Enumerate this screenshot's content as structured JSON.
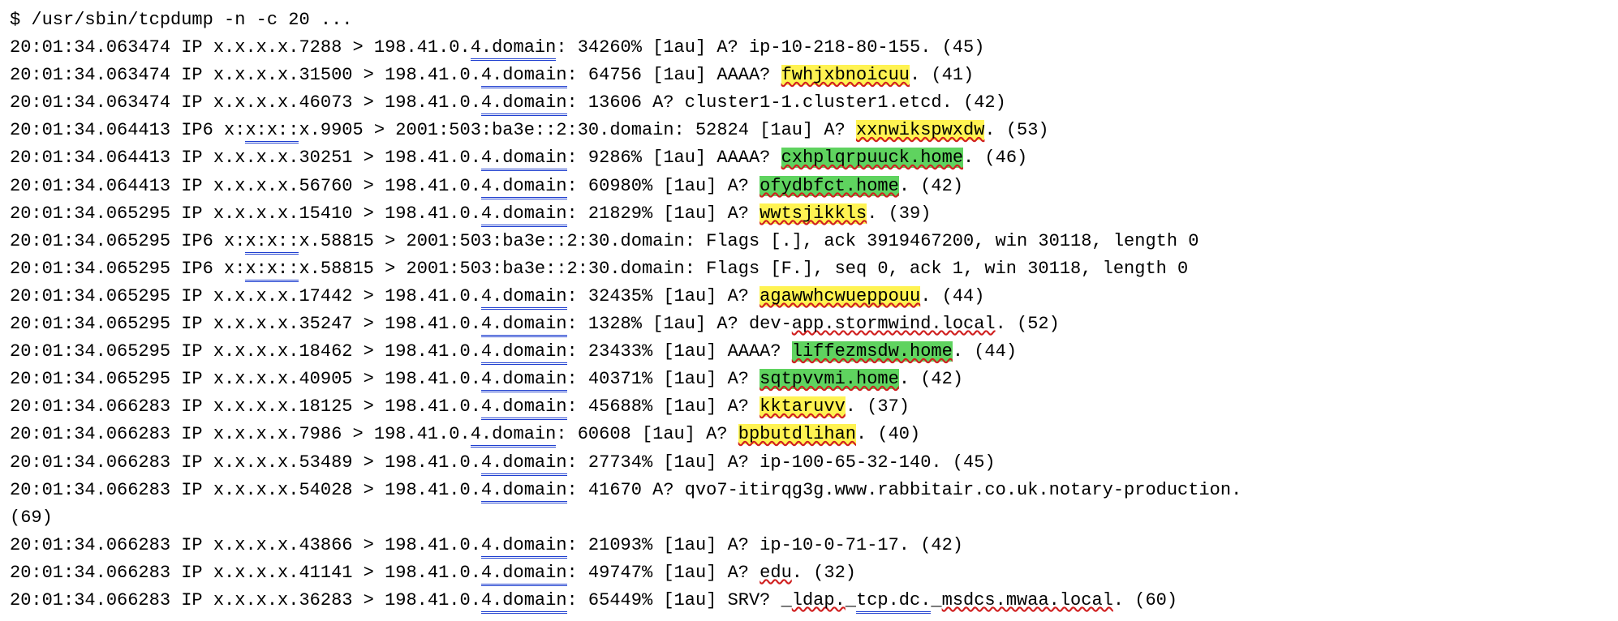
{
  "command": "$ /usr/sbin/tcpdump -n -c 20 ...",
  "lines": [
    {
      "segments": [
        {
          "text": "20:01:34.063474 IP x.x.x.x.7288 > 198.41.0."
        },
        {
          "text": "4.domain",
          "class": "ul-blue"
        },
        {
          "text": ": 34260% [1au] A? ip-10-218-80-155. (45)"
        }
      ]
    },
    {
      "segments": [
        {
          "text": "20:01:34.063474 IP x.x.x.x.31500 > 198.41.0."
        },
        {
          "text": "4.domain",
          "class": "ul-blue"
        },
        {
          "text": ": 64756 [1au] AAAA? "
        },
        {
          "text": "fwhjxbnoicuu",
          "class": "hl-yellow ul-red"
        },
        {
          "text": ". (41)"
        }
      ]
    },
    {
      "segments": [
        {
          "text": "20:01:34.063474 IP x.x.x.x.46073 > 198.41.0."
        },
        {
          "text": "4.domain",
          "class": "ul-blue"
        },
        {
          "text": ": 13606 A? cluster1-1.cluster1.etcd. (42)"
        }
      ]
    },
    {
      "segments": [
        {
          "text": "20:01:34.064413 IP6 x:"
        },
        {
          "text": "x:x::",
          "class": "ul-blue"
        },
        {
          "text": "x.9905 > 2001:503:ba3e::2:30.domain: 52824 [1au] A? "
        },
        {
          "text": "xxnwikspwxdw",
          "class": "hl-yellow ul-red"
        },
        {
          "text": ". (53)"
        }
      ]
    },
    {
      "segments": [
        {
          "text": "20:01:34.064413 IP x.x.x.x.30251 > 198.41.0."
        },
        {
          "text": "4.domain",
          "class": "ul-blue"
        },
        {
          "text": ": 9286% [1au] AAAA? "
        },
        {
          "text": "cxhplqrpuuck.home",
          "class": "hl-green ul-red"
        },
        {
          "text": ". (46)"
        }
      ]
    },
    {
      "segments": [
        {
          "text": "20:01:34.064413 IP x.x.x.x.56760 > 198.41.0."
        },
        {
          "text": "4.domain",
          "class": "ul-blue"
        },
        {
          "text": ": 60980% [1au] A? "
        },
        {
          "text": "ofydbfct.home",
          "class": "hl-green ul-red"
        },
        {
          "text": ". (42)"
        }
      ]
    },
    {
      "segments": [
        {
          "text": "20:01:34.065295 IP x.x.x.x.15410 > 198.41.0."
        },
        {
          "text": "4.domain",
          "class": "ul-blue"
        },
        {
          "text": ": 21829% [1au] A? "
        },
        {
          "text": "wwtsjikkls",
          "class": "hl-yellow ul-red"
        },
        {
          "text": ". (39)"
        }
      ]
    },
    {
      "segments": [
        {
          "text": "20:01:34.065295 IP6 x:"
        },
        {
          "text": "x:x::",
          "class": "ul-blue"
        },
        {
          "text": "x.58815 > 2001:503:ba3e::2:30.domain: Flags [.], ack 3919467200, win 30118, length 0"
        }
      ]
    },
    {
      "segments": [
        {
          "text": "20:01:34.065295 IP6 x:"
        },
        {
          "text": "x:x::",
          "class": "ul-blue"
        },
        {
          "text": "x.58815 > 2001:503:ba3e::2:30.domain: Flags [F.], seq 0, ack 1, win 30118, length 0"
        }
      ]
    },
    {
      "segments": [
        {
          "text": "20:01:34.065295 IP x.x.x.x.17442 > 198.41.0."
        },
        {
          "text": "4.domain",
          "class": "ul-blue"
        },
        {
          "text": ": 32435% [1au] A? "
        },
        {
          "text": "agawwhcwueppouu",
          "class": "hl-yellow ul-red"
        },
        {
          "text": ". (44)"
        }
      ]
    },
    {
      "segments": [
        {
          "text": "20:01:34.065295 IP x.x.x.x.35247 > 198.41.0."
        },
        {
          "text": "4.domain",
          "class": "ul-blue"
        },
        {
          "text": ": 1328% [1au] A? dev-"
        },
        {
          "text": "app.stormwind.local",
          "class": "ul-red"
        },
        {
          "text": ". (52)"
        }
      ]
    },
    {
      "segments": [
        {
          "text": "20:01:34.065295 IP x.x.x.x.18462 > 198.41.0."
        },
        {
          "text": "4.domain",
          "class": "ul-blue"
        },
        {
          "text": ": 23433% [1au] AAAA? "
        },
        {
          "text": "liffezmsdw.home",
          "class": "hl-green ul-red"
        },
        {
          "text": ". (44)"
        }
      ]
    },
    {
      "segments": [
        {
          "text": "20:01:34.065295 IP x.x.x.x.40905 > 198.41.0."
        },
        {
          "text": "4.domain",
          "class": "ul-blue"
        },
        {
          "text": ": 40371% [1au] A? "
        },
        {
          "text": "sqtpvvmi.home",
          "class": "hl-green ul-red"
        },
        {
          "text": ". (42)"
        }
      ]
    },
    {
      "segments": [
        {
          "text": "20:01:34.066283 IP x.x.x.x.18125 > 198.41.0."
        },
        {
          "text": "4.domain",
          "class": "ul-blue"
        },
        {
          "text": ": 45688% [1au] A? "
        },
        {
          "text": "kktaruvv",
          "class": "hl-yellow ul-red"
        },
        {
          "text": ". (37)"
        }
      ]
    },
    {
      "segments": [
        {
          "text": "20:01:34.066283 IP x.x.x.x.7986 > 198.41.0."
        },
        {
          "text": "4.domain",
          "class": "ul-blue"
        },
        {
          "text": ": 60608 [1au] A? "
        },
        {
          "text": "bpbutdlihan",
          "class": "hl-yellow ul-red"
        },
        {
          "text": ". (40)"
        }
      ]
    },
    {
      "segments": [
        {
          "text": "20:01:34.066283 IP x.x.x.x.53489 > 198.41.0."
        },
        {
          "text": "4.domain",
          "class": "ul-blue"
        },
        {
          "text": ": 27734% [1au] A? ip-100-65-32-140. (45)"
        }
      ]
    },
    {
      "segments": [
        {
          "text": "20:01:34.066283 IP x.x.x.x.54028 > 198.41.0."
        },
        {
          "text": "4.domain",
          "class": "ul-blue"
        },
        {
          "text": ": 41670 A? qvo7-itirqg3g.www.rabbitair.co.uk.notary-production."
        }
      ]
    },
    {
      "segments": [
        {
          "text": "(69)"
        }
      ]
    },
    {
      "segments": [
        {
          "text": "20:01:34.066283 IP x.x.x.x.43866 > 198.41.0."
        },
        {
          "text": "4.domain",
          "class": "ul-blue"
        },
        {
          "text": ": 21093% [1au] A? ip-10-0-71-17. (42)"
        }
      ]
    },
    {
      "segments": [
        {
          "text": "20:01:34.066283 IP x.x.x.x.41141 > 198.41.0."
        },
        {
          "text": "4.domain",
          "class": "ul-blue"
        },
        {
          "text": ": 49747% [1au] A? "
        },
        {
          "text": "edu",
          "class": "ul-red"
        },
        {
          "text": ". (32)"
        }
      ]
    },
    {
      "segments": [
        {
          "text": "20:01:34.066283 IP x.x.x.x.36283 > 198.41.0."
        },
        {
          "text": "4.domain",
          "class": "ul-blue"
        },
        {
          "text": ": 65449% [1au] SRV? _"
        },
        {
          "text": "ldap.",
          "class": "ul-red"
        },
        {
          "text": "_"
        },
        {
          "text": "tcp.dc.",
          "class": "ul-blue"
        },
        {
          "text": "_"
        },
        {
          "text": "msdcs.mwaa.local",
          "class": "ul-red"
        },
        {
          "text": ". (60)"
        }
      ]
    }
  ]
}
